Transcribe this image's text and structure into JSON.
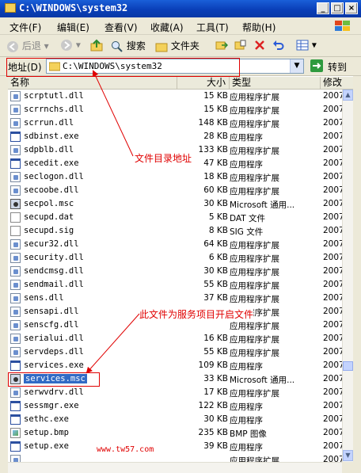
{
  "window": {
    "title": "C:\\WINDOWS\\system32"
  },
  "menu": [
    "文件(F)",
    "编辑(E)",
    "查看(V)",
    "收藏(A)",
    "工具(T)",
    "帮助(H)"
  ],
  "toolbar": {
    "back": "后退",
    "search": "搜索",
    "folders": "文件夹"
  },
  "address": {
    "label": "地址(D)",
    "value": "C:\\WINDOWS\\system32",
    "go": "转到"
  },
  "columns": [
    "名称",
    "大小",
    "类型",
    "修改"
  ],
  "files": [
    {
      "name": "scrptutl.dll",
      "size": "15 KB",
      "type": "应用程序扩展",
      "date": "2007",
      "icon": "dll"
    },
    {
      "name": "scrrnchs.dll",
      "size": "15 KB",
      "type": "应用程序扩展",
      "date": "2007",
      "icon": "dll"
    },
    {
      "name": "scrrun.dll",
      "size": "148 KB",
      "type": "应用程序扩展",
      "date": "2007",
      "icon": "dll"
    },
    {
      "name": "sdbinst.exe",
      "size": "28 KB",
      "type": "应用程序",
      "date": "2007",
      "icon": "exe"
    },
    {
      "name": "sdpblb.dll",
      "size": "133 KB",
      "type": "应用程序扩展",
      "date": "2007",
      "icon": "dll"
    },
    {
      "name": "secedit.exe",
      "size": "47 KB",
      "type": "应用程序",
      "date": "2007",
      "icon": "exe"
    },
    {
      "name": "seclogon.dll",
      "size": "18 KB",
      "type": "应用程序扩展",
      "date": "2007",
      "icon": "dll"
    },
    {
      "name": "secoobe.dll",
      "size": "60 KB",
      "type": "应用程序扩展",
      "date": "2007",
      "icon": "dll"
    },
    {
      "name": "secpol.msc",
      "size": "30 KB",
      "type": "Microsoft 通用...",
      "date": "2007",
      "icon": "msc"
    },
    {
      "name": "secupd.dat",
      "size": "5 KB",
      "type": "DAT 文件",
      "date": "2007",
      "icon": "dat"
    },
    {
      "name": "secupd.sig",
      "size": "8 KB",
      "type": "SIG 文件",
      "date": "2007",
      "icon": "dat"
    },
    {
      "name": "secur32.dll",
      "size": "64 KB",
      "type": "应用程序扩展",
      "date": "2007",
      "icon": "dll"
    },
    {
      "name": "security.dll",
      "size": "6 KB",
      "type": "应用程序扩展",
      "date": "2007",
      "icon": "dll"
    },
    {
      "name": "sendcmsg.dll",
      "size": "30 KB",
      "type": "应用程序扩展",
      "date": "2007",
      "icon": "dll"
    },
    {
      "name": "sendmail.dll",
      "size": "55 KB",
      "type": "应用程序扩展",
      "date": "2007",
      "icon": "dll"
    },
    {
      "name": "sens.dll",
      "size": "37 KB",
      "type": "应用程序扩展",
      "date": "2007",
      "icon": "dll"
    },
    {
      "name": "sensapi.dll",
      "size": "",
      "type": "应用程序扩展",
      "date": "2007",
      "icon": "dll"
    },
    {
      "name": "senscfg.dll",
      "size": "",
      "type": "应用程序扩展",
      "date": "2007",
      "icon": "dll"
    },
    {
      "name": "serialui.dll",
      "size": "16 KB",
      "type": "应用程序扩展",
      "date": "2007",
      "icon": "dll"
    },
    {
      "name": "servdeps.dll",
      "size": "55 KB",
      "type": "应用程序扩展",
      "date": "2007",
      "icon": "dll"
    },
    {
      "name": "services.exe",
      "size": "109 KB",
      "type": "应用程序",
      "date": "2007",
      "icon": "exe"
    },
    {
      "name": "services.msc",
      "size": "33 KB",
      "type": "Microsoft 通用...",
      "date": "2007",
      "icon": "msc",
      "selected": true
    },
    {
      "name": "serwvdrv.dll",
      "size": "17 KB",
      "type": "应用程序扩展",
      "date": "2007",
      "icon": "dll"
    },
    {
      "name": "sessmgr.exe",
      "size": "122 KB",
      "type": "应用程序",
      "date": "2007",
      "icon": "exe"
    },
    {
      "name": "sethc.exe",
      "size": "30 KB",
      "type": "应用程序",
      "date": "2007",
      "icon": "exe"
    },
    {
      "name": "setup.bmp",
      "size": "235 KB",
      "type": "BMP 图像",
      "date": "2007",
      "icon": "bmp"
    },
    {
      "name": "setup.exe",
      "size": "39 KB",
      "type": "应用程序",
      "date": "2007",
      "icon": "exe"
    },
    {
      "name": "",
      "size": "",
      "type": "应用程序扩展",
      "date": "2007",
      "icon": "dll"
    }
  ],
  "annotations": {
    "address_note": "文件目录地址",
    "services_note": "此文件为服务项目开启文件"
  },
  "watermark": "www.tw57.com",
  "colors": {
    "titlebar": "#0a3fb8",
    "annotation": "#e00000",
    "selection": "#316ac5"
  }
}
